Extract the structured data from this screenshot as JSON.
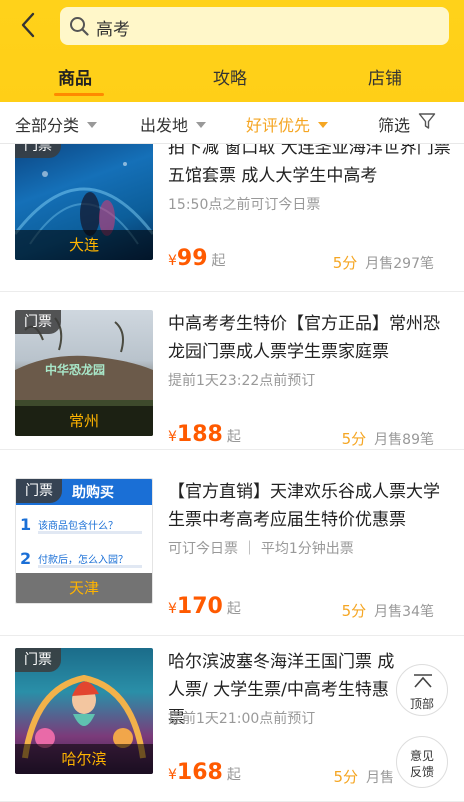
{
  "header": {
    "search_query": "高考",
    "tabs": [
      "商品",
      "攻略",
      "店铺"
    ]
  },
  "filters": {
    "items": [
      "全部分类",
      "出发地",
      "好评优先",
      "筛选"
    ]
  },
  "products": [
    {
      "tag": "门票",
      "city": "大连",
      "title": "拍下减 窗口取 大连圣亚海洋世界门票 五馆套票 成人大学生中高考",
      "subtitle": "15:50点之前可订今日票",
      "currency": "¥",
      "price": "99",
      "price_suffix": "起",
      "score": "5分",
      "sales": "月售297笔"
    },
    {
      "tag": "门票",
      "city": "常州",
      "title": "中高考考生特价【官方正品】常州恐龙园门票成人票学生票家庭票",
      "subtitle": "提前1天23:22点前预订",
      "currency": "¥",
      "price": "188",
      "price_suffix": "起",
      "score": "5分",
      "sales": "月售89笔"
    },
    {
      "tag": "门票",
      "city": "天津",
      "title": "【官方直销】天津欢乐谷成人票大学生票中考高考应届生特价优惠票",
      "subtitle": "可订今日票 ｜ 平均1分钟出票",
      "currency": "¥",
      "price": "170",
      "price_suffix": "起",
      "score": "5分",
      "sales": "月售34笔",
      "thumb_text": {
        "heading": "助购买",
        "q1": "该商品包含什么？",
        "q2": "付款后，怎么入园？"
      }
    },
    {
      "tag": "门票",
      "city": "哈尔滨",
      "title": "哈尔滨波塞冬海洋王国门票  成人票/ 大学生票/中高考生特惠票",
      "subtitle": "提前1天21:00点前预订",
      "currency": "¥",
      "price": "168",
      "price_suffix": "起",
      "score": "5分",
      "sales": "月售"
    }
  ],
  "floating": {
    "top_label": "顶部",
    "feedback_line1": "意见",
    "feedback_line2": "反馈"
  },
  "colors": {
    "header": "#ffd21a",
    "accent_orange": "#f5a623",
    "price_red": "#ff5a00"
  },
  "icons": [
    "back-arrow-icon",
    "search-icon",
    "caret-down-icon",
    "funnel-icon",
    "arrow-up-icon"
  ]
}
